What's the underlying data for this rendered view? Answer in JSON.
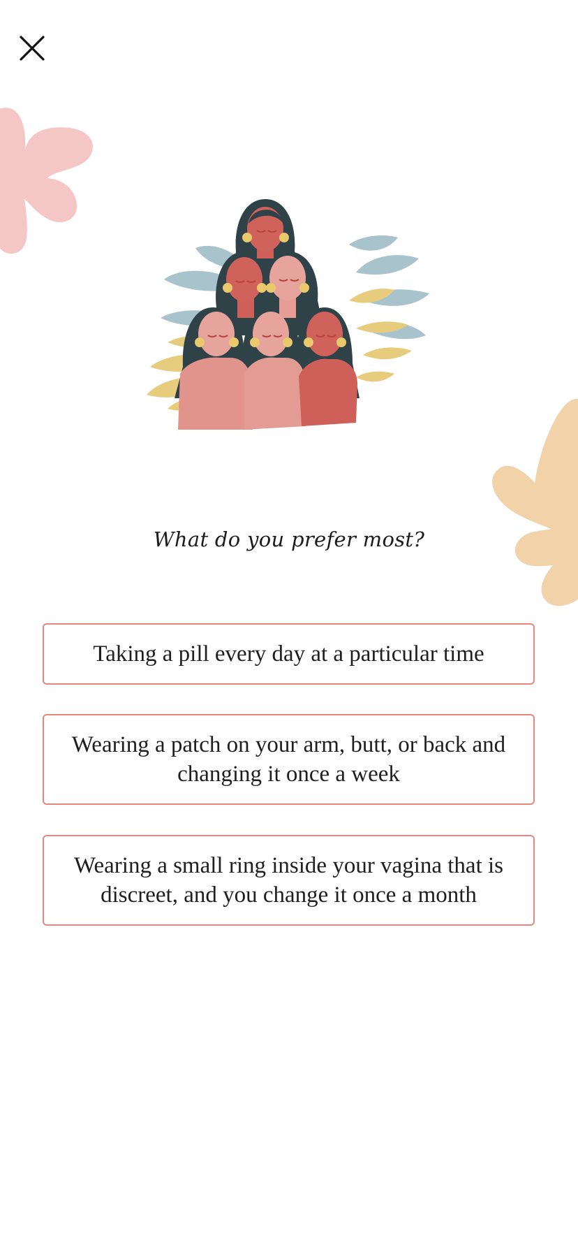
{
  "header": {
    "close_icon": "close-icon"
  },
  "colors": {
    "option_border": "#e8867e",
    "blob_pink": "#f5c6c6",
    "blob_peach": "#f2d2a9",
    "text": "#1e1e1e"
  },
  "illustration": {
    "icon": "women-group-illustration"
  },
  "question": {
    "text": "What do you prefer most?"
  },
  "options": [
    {
      "label": "Taking a pill every day at a particular time"
    },
    {
      "label": "Wearing a patch on your arm, butt, or back and changing it once a week"
    },
    {
      "label": "Wearing a small ring inside your vagina that is discreet, and you change it once a month"
    }
  ]
}
